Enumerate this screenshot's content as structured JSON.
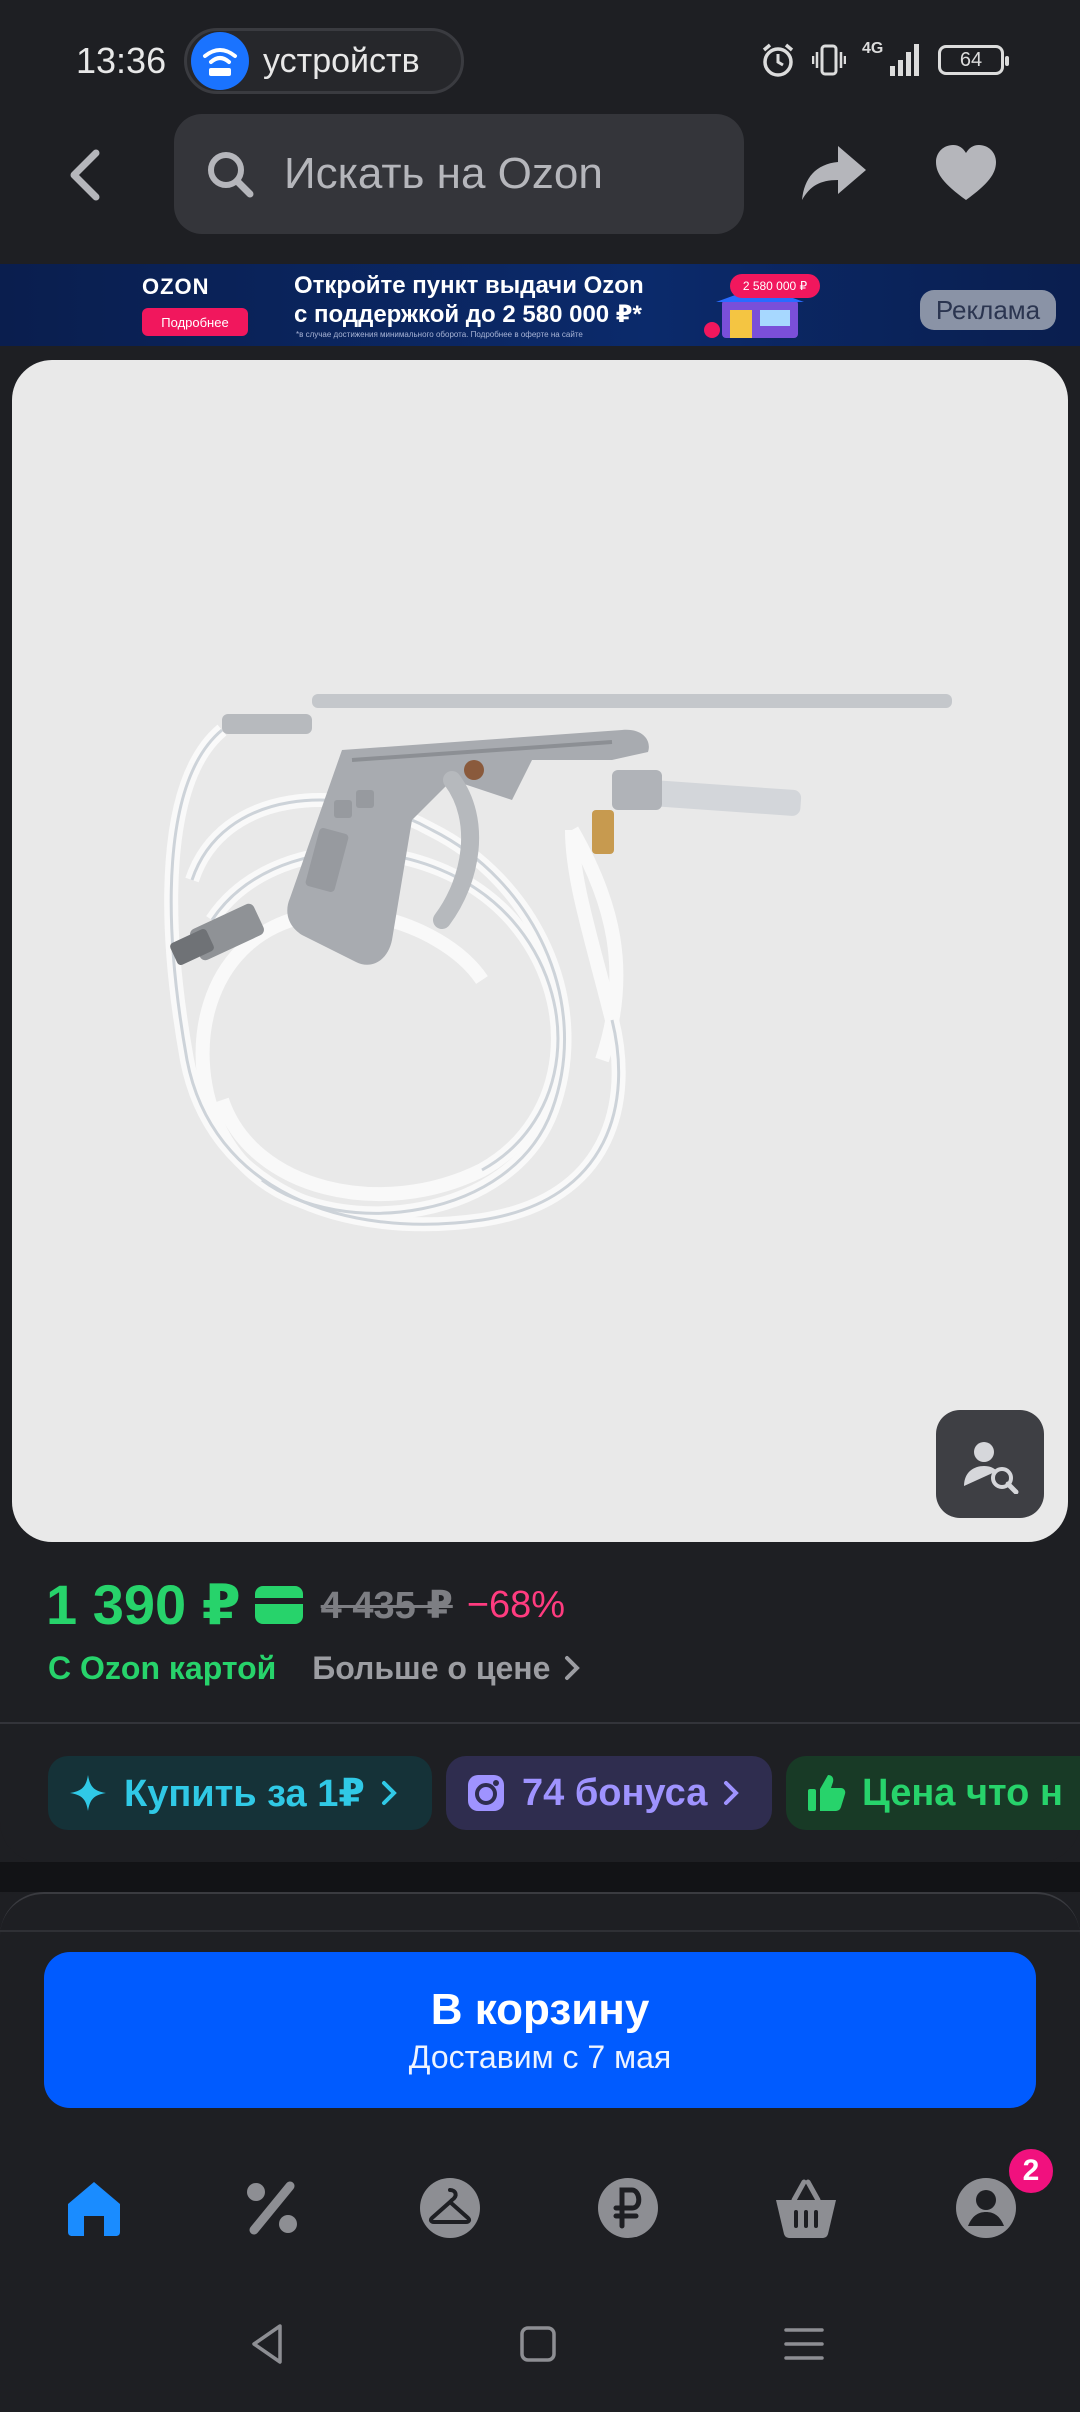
{
  "status_bar": {
    "time": "13:36",
    "pill_text": "устройств",
    "network": "4G",
    "battery": "64"
  },
  "header": {
    "search_placeholder": "Искать на Ozon"
  },
  "ad_banner": {
    "brand": "OZON",
    "more_label": "Подробнее",
    "line1": "Откройте пункт выдачи Ozon",
    "line2": "с поддержкой до 2 580 000 ₽*",
    "fine_print": "*в случае достижения минимального оборота. Подробнее в оферте на сайте",
    "price_badge": "2 580 000 ₽",
    "ad_label": "Реклама"
  },
  "price": {
    "current": "1 390 ₽",
    "old": "4 435 ₽",
    "discount": "−68%",
    "ozon_card_label": "С Ozon картой",
    "more_label": "Больше о цене"
  },
  "chips": {
    "buy_for_1": "Купить за 1₽",
    "bonus": "74 бонуса",
    "price_label": "Цена что н"
  },
  "cart": {
    "title": "В корзину",
    "delivery": "Доставим с 7 мая"
  },
  "nav": {
    "profile_badge": "2"
  },
  "colors": {
    "accent_blue": "#005bff",
    "price_green": "#27d36b",
    "discount_pink": "#ff3b7f",
    "badge_pink": "#f1117e"
  }
}
